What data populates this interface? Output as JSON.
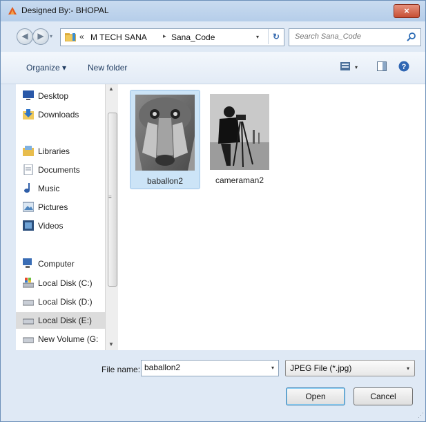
{
  "window": {
    "title": "Designed By:- BHOPAL",
    "close_glyph": "×",
    "accent_color": "#c74f35"
  },
  "navigation": {
    "back_glyph": "◀",
    "forward_glyph": "▶",
    "dropdown_glyph": "▾"
  },
  "address": {
    "overflow": "«",
    "crumbs": [
      "M TECH SANA",
      "Sana_Code"
    ],
    "separator": "▸",
    "dropdown_glyph": "▾",
    "refresh_glyph": "↻"
  },
  "search": {
    "placeholder": "Search Sana_Code",
    "icon": "search-icon"
  },
  "toolbar": {
    "organize_label": "Organize ▾",
    "new_folder_label": "New folder",
    "views_drop": "▾"
  },
  "nav_pane": {
    "items": [
      {
        "label": "Desktop",
        "icon": "desktop-icon"
      },
      {
        "label": "Downloads",
        "icon": "downloads-icon"
      },
      {
        "label": "Libraries",
        "icon": "libraries-icon"
      },
      {
        "label": "Documents",
        "icon": "documents-icon"
      },
      {
        "label": "Music",
        "icon": "music-icon"
      },
      {
        "label": "Pictures",
        "icon": "pictures-icon"
      },
      {
        "label": "Videos",
        "icon": "videos-icon"
      },
      {
        "label": "Computer",
        "icon": "computer-icon"
      },
      {
        "label": "Local Disk (C:)",
        "icon": "drive-icon"
      },
      {
        "label": "Local Disk (D:)",
        "icon": "drive-icon"
      },
      {
        "label": "Local Disk (E:)",
        "icon": "drive-icon",
        "selected": true
      },
      {
        "label": "New Volume (G:",
        "icon": "drive-icon"
      }
    ]
  },
  "scrollbar": {
    "up": "▲",
    "down": "▼",
    "grip": "≡"
  },
  "files": [
    {
      "name": "baballon2",
      "selected": true
    },
    {
      "name": "cameraman2",
      "selected": false
    }
  ],
  "footer": {
    "file_name_label": "File name:",
    "file_name_value": "baballon2",
    "file_name_drop": "▾",
    "filter_value": "JPEG File (*.jpg)",
    "filter_drop": "▾",
    "open_label": "Open",
    "cancel_label": "Cancel",
    "grip": "⋰"
  }
}
